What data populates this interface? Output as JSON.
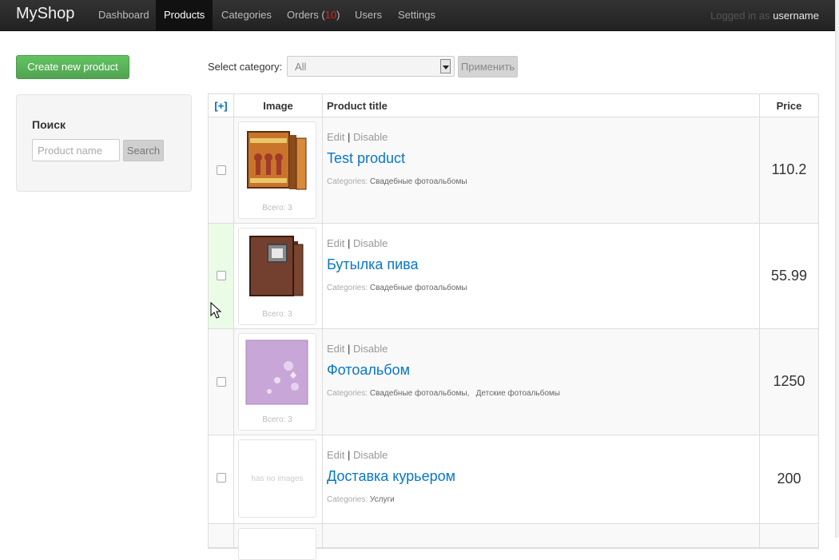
{
  "navbar": {
    "brand": "MyShop",
    "items": [
      "Dashboard",
      "Products",
      "Categories",
      "Orders (",
      "Users",
      "Settings"
    ],
    "orders_count": "10",
    "orders_close": ")",
    "logged_in_prefix": "Logged in as",
    "username": "username"
  },
  "sidebar": {
    "create_button": "Create new product",
    "search_title": "Поиск",
    "search_placeholder": "Product name",
    "search_button": "Search"
  },
  "filter": {
    "label": "Select category:",
    "selected": "All",
    "apply_button": "Применить"
  },
  "table": {
    "select_all": "[+]",
    "headers": {
      "image": "Image",
      "title": "Product title",
      "price": "Price"
    },
    "edit_label": "Edit",
    "sep": "|",
    "disable_label": "Disable",
    "categories_label": "Categories:",
    "rows": [
      {
        "title": "Test product",
        "price": "110.2",
        "image_count": "Всего: 3",
        "categories": [
          "Свадебные фотоальбомы"
        ]
      },
      {
        "title": "Бутылка пива",
        "price": "55.99",
        "image_count": "Всего: 3",
        "categories": [
          "Свадебные фотоальбомы"
        ]
      },
      {
        "title": "Фотоальбом",
        "price": "1250",
        "image_count": "Всего: 3",
        "categories": [
          "Свадебные фотоальбомы,",
          "Детские фотоальбомы"
        ]
      },
      {
        "title": "Доставка курьером",
        "price": "200",
        "no_images": "has no images",
        "categories": [
          "Услуги"
        ]
      }
    ]
  },
  "colors": {
    "nav_bg": "#222222",
    "create_button": "#5bb75b",
    "link": "#0877c9",
    "orders_count": "#e02020"
  }
}
